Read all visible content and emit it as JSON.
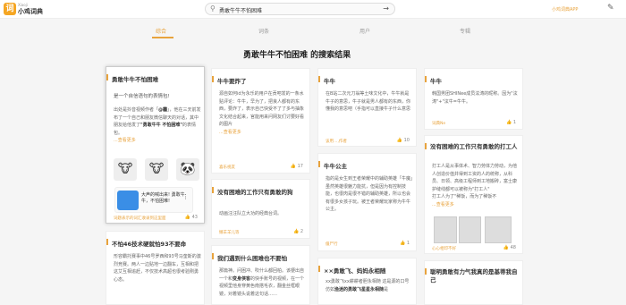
{
  "topbar": {
    "logo_glyph": "词",
    "brand_en": "Xiaoji",
    "brand_cn": "小鸡词典",
    "search_value": "勇敢牛牛不怕困难",
    "app_link": "小鸡词典APP",
    "search_icon": "search-icon",
    "arrow_icon": "arrow-right-icon",
    "edit_icon": "edit-icon"
  },
  "tabs": [
    "综合",
    "词条",
    "用户",
    "专辑"
  ],
  "page_title": "勇敢牛牛不怕困难 的搜索结果",
  "cards": {
    "c1": {
      "title": "勇敢牛牛不怕困难",
      "sub": "是一个自信语句的表情包!",
      "body1": "出处是抖音视频作者「",
      "author": "@霾",
      "body2": "」，他在三天前发布了一个自己和朋友微信聊天的对话，其中朋友给他发了",
      "quote": "\"勇敢牛牛 不怕困难\"",
      "body3": "的表情包。",
      "more": "...查看更多",
      "video_text": "大声的喊出来! 勇敢牛牛，不怕困难!",
      "dots": "⋮",
      "footer": "词题表示的词汇收录到这里面",
      "likes": "43"
    },
    "c2": {
      "title": "牛牛要炸了",
      "body": "源自如何id为永乐的用户在贡吧发的一条水贴评论：牛牛，早为了，把良人都有的东西，要炸了，表示自己快受不了了多与抽象文化结合起来，官能用来问网友们讨要好看的图片",
      "more": "...查看更多",
      "footer": "喜乐视友",
      "likes": "17"
    },
    "c3": {
      "title": "牛牛",
      "body": "在B站二次元刀翁等土味文化中，牛牛就是牛子的意思，牛子就是男人都有的东西，你懂我的意思吧（手指可以直接牛子什么意思",
      "footer": "该用…,作者",
      "likes": "10"
    },
    "c4": {
      "title": "牛牛",
      "body": "韩国男团SHINee成员泫涛的昵称。因为\"泫涛\"+\"泫牛=牛牛。",
      "footer": "词典Ne",
      "likes": "1"
    },
    "c5": {
      "title": "没有困难的工作只有勇敢的狗",
      "body": "动画汪汪队立大功的经典台词。",
      "footer": "懒羊羊儿等",
      "likes": "2"
    },
    "c6": {
      "title": "牛牛公主",
      "body": "指的是女生到王者荣耀中的辅助英雄「牛魔」虽然英雄很魅力能抗，但是因为有控制技能，也很肉是很不错的辅助英雄，所以也会有很多女孩子玩。被王者荣耀玩家称为牛牛公主。",
      "footer": "僵尸行",
      "likes": "1"
    },
    "c7": {
      "title": "没有困难的工作只有勇敢的打工人",
      "body": "打工人是从事体术、智力劳体力劳动，为他人创造价值并得到工资的人的统称，从科员、日领、高级工程师到工地搬砖，富士康护缝线都可以被称为\"打工人\"",
      "body2": "打工人为了\"稀饭，而为了稀饭不",
      "more": "...查看更多",
      "footer": "心心相印不好",
      "likes": "48"
    },
    "c8": {
      "title": "不怕46技术硬就怕93不要命",
      "body": "形容霸托赛事中46号罗西和93号马奎斯的激烈竞赛。两人一边贴地一边翻车，互相和把这艾互相追赶，不仅技术高超也很考验刚勇心态。"
    },
    "c9": {
      "title": "我们遇到什么困难也不要怕",
      "body": "那篇神。问困冲、吹什么都回柏。该梗出自一个和",
      "bold": "变身侠客",
      "body2": "的快手账号的视频，在一个视频里他身穿黄色南搭毛衣，翻金丝框眼镜，对着镜头说着这句话……"
    },
    "c10": {
      "title": "××勇敢飞、妈妈永相随",
      "body1": "xx勇敢飞xx耕耕者胆永相随 这是源的口号",
      "body2": "仿如",
      "bold": "渔迷的勇敢飞星星永相随",
      "body3": "是"
    },
    "c11": {
      "title": "聪明勇敢有力气我真的是基蒂我自己"
    }
  }
}
